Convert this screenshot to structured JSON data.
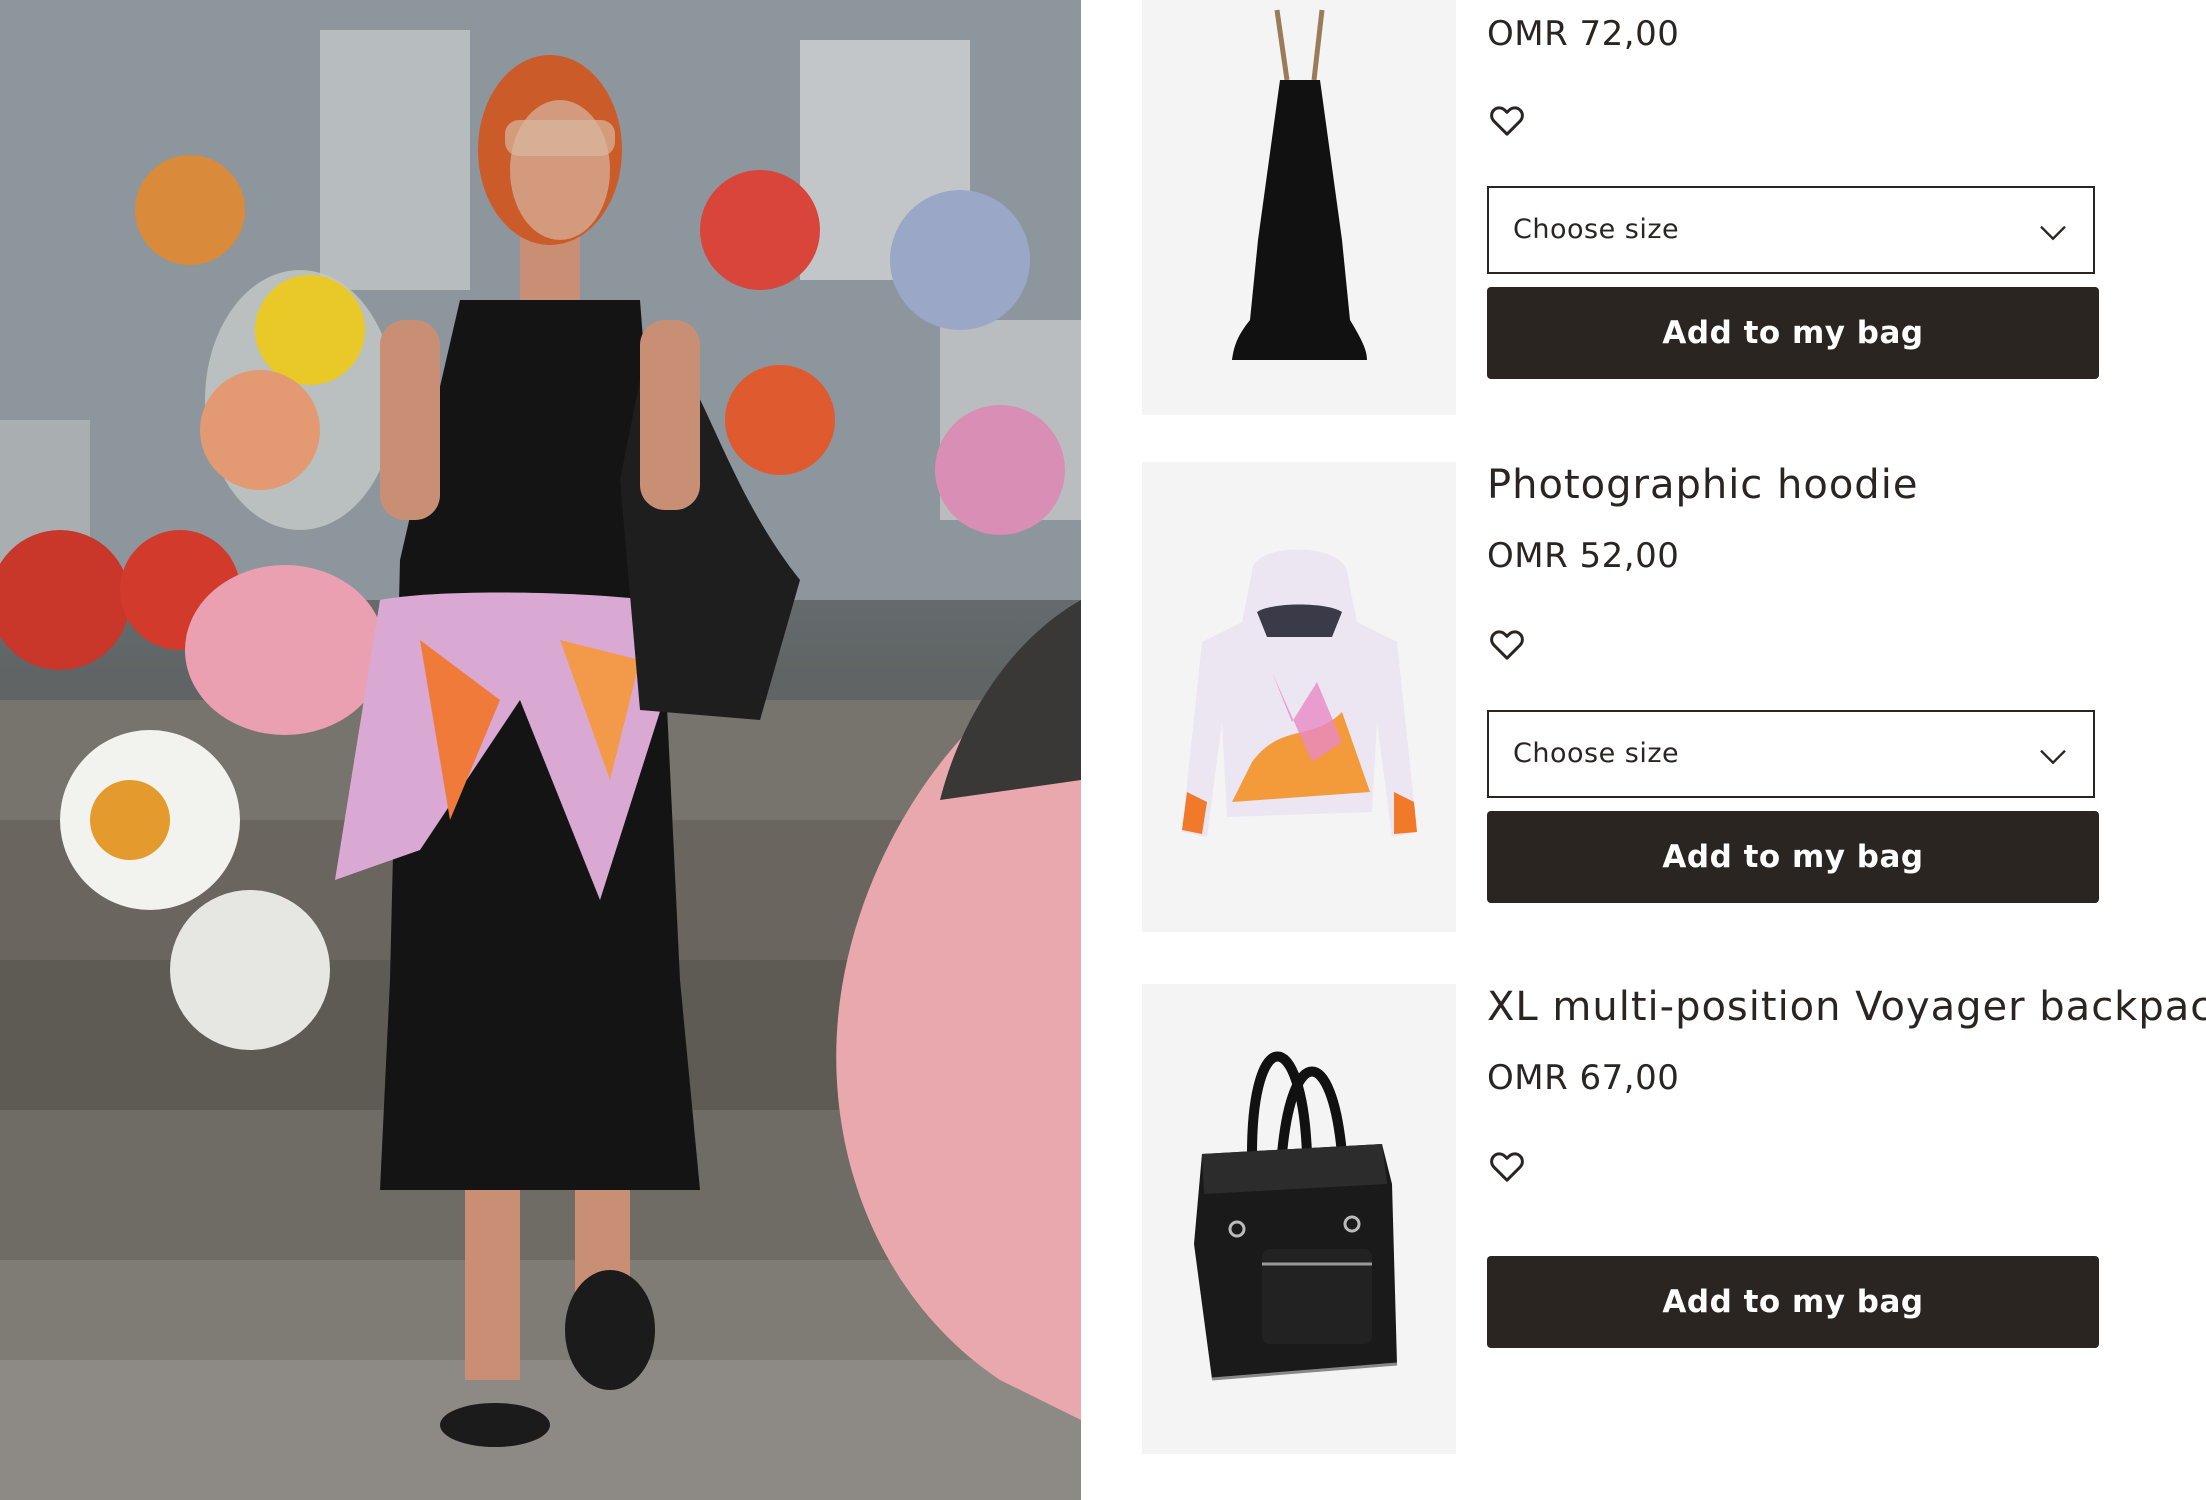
{
  "products": [
    {
      "name": "",
      "price": "OMR 72,00",
      "size_label": "Choose size",
      "button_label": "Add to my bag",
      "image": "black halter maxi dress"
    },
    {
      "name": "Photographic hoodie",
      "price": "OMR 52,00",
      "size_label": "Choose size",
      "button_label": "Add to my bag",
      "image": "white hoodie with orange and pink floral print"
    },
    {
      "name": "XL multi-position Voyager backpack",
      "price": "OMR 67,00",
      "size_label": "",
      "button_label": "Add to my bag",
      "image": "black quilted backpack tote"
    }
  ],
  "icons": {
    "wishlist": "heart-outline-icon",
    "dropdown": "chevron-down-icon"
  },
  "colors": {
    "button_bg": "#2b2522",
    "button_text": "#ffffff",
    "text": "#2b2522"
  }
}
